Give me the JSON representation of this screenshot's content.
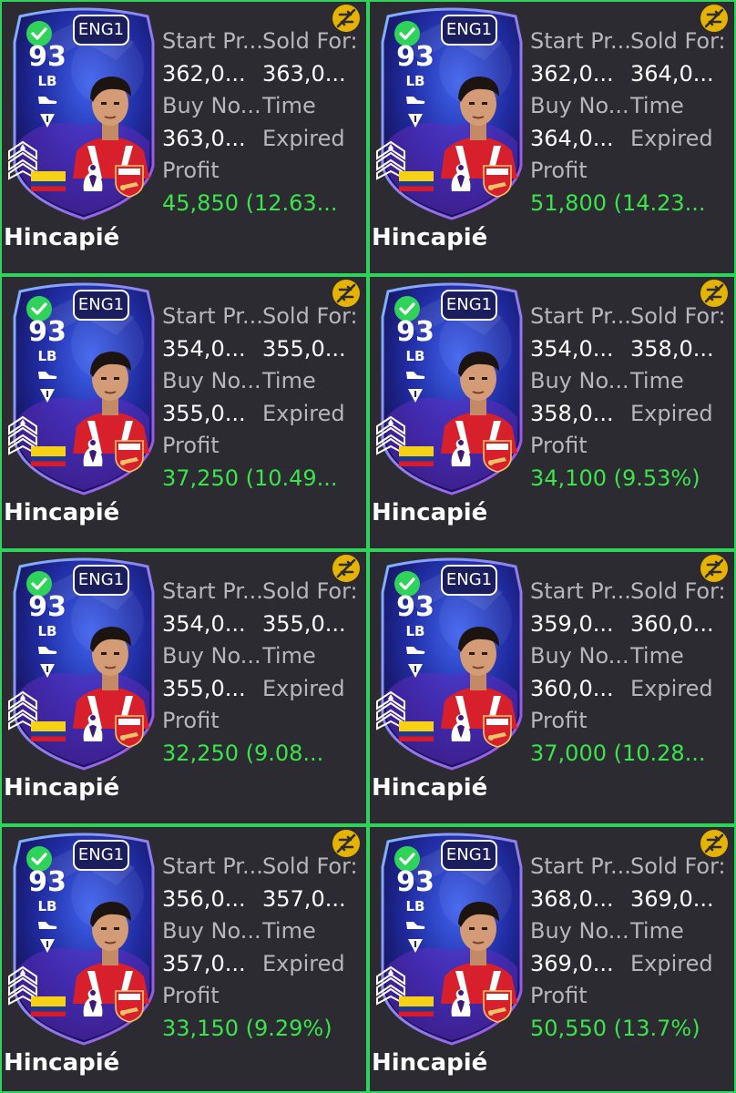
{
  "labels": {
    "start_price": "Start Pr...",
    "sold_for": "Sold For:",
    "buy_now": "Buy No...",
    "time": "Time",
    "profit": "Profit",
    "expired": "Expired"
  },
  "colors": {
    "border": "#2fd35a",
    "profit": "#39e54a",
    "label": "#b6b6bc",
    "tile_bg": "#2b2b31",
    "untradeable": "#e6b300",
    "check": "#2fd35a"
  },
  "icons": {
    "check": "check-icon",
    "untradeable": "untradeable-icon",
    "boot": "boot-icon",
    "chemistry": "chemistry-style-icon"
  },
  "cards": [
    {
      "league": "ENG1",
      "rating": "93",
      "position": "LB",
      "name": "Hincapié",
      "start_price": "362,0...",
      "sold_for": "363,0...",
      "buy_now": "363,0...",
      "time": "Expired",
      "profit": "45,850 (12.63..."
    },
    {
      "league": "ENG1",
      "rating": "93",
      "position": "LB",
      "name": "Hincapié",
      "start_price": "362,0...",
      "sold_for": "364,0...",
      "buy_now": "364,0...",
      "time": "Expired",
      "profit": "51,800 (14.23..."
    },
    {
      "league": "ENG1",
      "rating": "93",
      "position": "LB",
      "name": "Hincapié",
      "start_price": "354,0...",
      "sold_for": "355,0...",
      "buy_now": "355,0...",
      "time": "Expired",
      "profit": "37,250 (10.49..."
    },
    {
      "league": "ENG1",
      "rating": "93",
      "position": "LB",
      "name": "Hincapié",
      "start_price": "354,0...",
      "sold_for": "358,0...",
      "buy_now": "358,0...",
      "time": "Expired",
      "profit": "34,100 (9.53%)"
    },
    {
      "league": "ENG1",
      "rating": "93",
      "position": "LB",
      "name": "Hincapié",
      "start_price": "354,0...",
      "sold_for": "355,0...",
      "buy_now": "355,0...",
      "time": "Expired",
      "profit": "32,250 (9.08..."
    },
    {
      "league": "ENG1",
      "rating": "93",
      "position": "LB",
      "name": "Hincapié",
      "start_price": "359,0...",
      "sold_for": "360,0...",
      "buy_now": "360,0...",
      "time": "Expired",
      "profit": "37,000 (10.28..."
    },
    {
      "league": "ENG1",
      "rating": "93",
      "position": "LB",
      "name": "Hincapié",
      "start_price": "356,0...",
      "sold_for": "357,0...",
      "buy_now": "357,0...",
      "time": "Expired",
      "profit": "33,150 (9.29%)"
    },
    {
      "league": "ENG1",
      "rating": "93",
      "position": "LB",
      "name": "Hincapié",
      "start_price": "368,0...",
      "sold_for": "369,0...",
      "buy_now": "369,0...",
      "time": "Expired",
      "profit": "50,550 (13.7%)"
    }
  ]
}
